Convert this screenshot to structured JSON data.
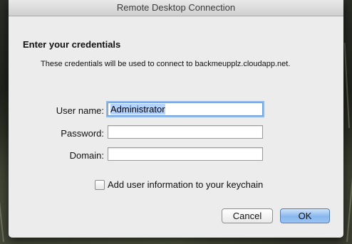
{
  "window": {
    "title": "Remote Desktop Connection"
  },
  "dialog": {
    "heading": "Enter your credentials",
    "description": "These credentials will be used to connect to backmeupplz.cloudapp.net.",
    "fields": {
      "username": {
        "label": "User name:",
        "value": "Administrator"
      },
      "password": {
        "label": "Password:",
        "value": ""
      },
      "domain": {
        "label": "Domain:",
        "value": ""
      }
    },
    "keychain_checkbox": {
      "label": "Add user information to your keychain",
      "checked": false
    },
    "buttons": {
      "cancel": "Cancel",
      "ok": "OK"
    }
  }
}
